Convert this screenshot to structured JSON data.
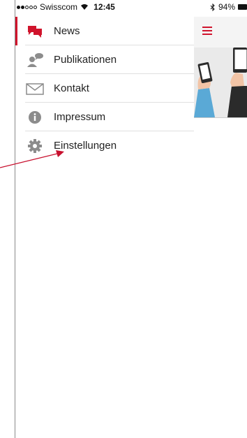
{
  "status_bar": {
    "carrier": "Swisscom",
    "time": "12:45",
    "battery": "94%"
  },
  "drawer": {
    "items": [
      {
        "label": "News",
        "icon": "news-chat-icon",
        "active": true
      },
      {
        "label": "Publikationen",
        "icon": "people-chat-icon",
        "active": false
      },
      {
        "label": "Kontakt",
        "icon": "envelope-icon",
        "active": false
      },
      {
        "label": "Impressum",
        "icon": "info-icon",
        "active": false
      },
      {
        "label": "Einstellungen",
        "icon": "gear-icon",
        "active": false
      }
    ]
  },
  "colors": {
    "accent": "#d0142c",
    "icon_gray": "#8c8c8c"
  }
}
